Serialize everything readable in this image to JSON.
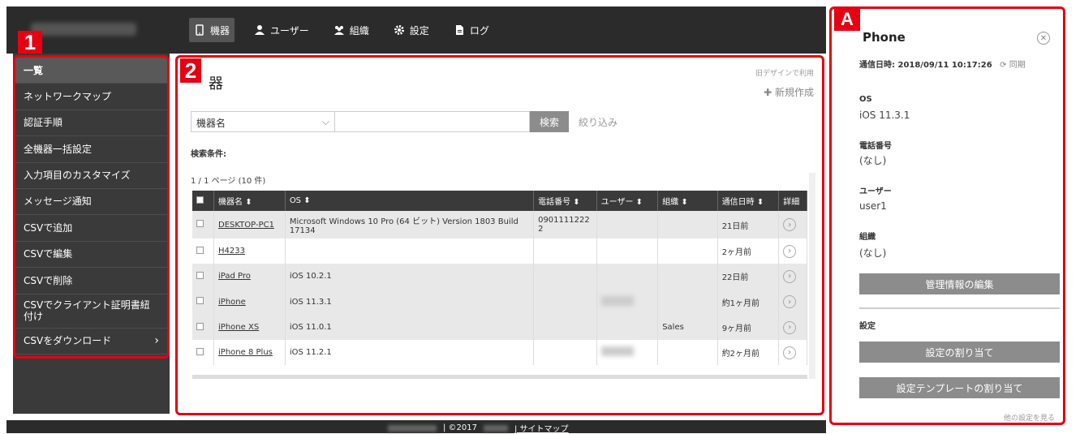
{
  "nav": {
    "items": [
      {
        "label": "機器",
        "icon": "phone-icon",
        "active": true
      },
      {
        "label": "ユーザー",
        "icon": "user-icon",
        "active": false
      },
      {
        "label": "組織",
        "icon": "group-icon",
        "active": false
      },
      {
        "label": "設定",
        "icon": "gear-icon",
        "active": false
      },
      {
        "label": "ログ",
        "icon": "document-icon",
        "active": false
      }
    ]
  },
  "badges": {
    "one": "1",
    "two": "2",
    "a": "A"
  },
  "sidebar": {
    "items": [
      {
        "label": "一覧"
      },
      {
        "label": "ネットワークマップ"
      },
      {
        "label": "認証手順"
      },
      {
        "label": "全機器一括設定"
      },
      {
        "label": "入力項目のカスタマイズ"
      },
      {
        "label": "メッセージ通知"
      },
      {
        "label": "CSVで追加"
      },
      {
        "label": "CSVで編集"
      },
      {
        "label": "CSVで削除"
      },
      {
        "label": "CSVでクライアント証明書紐付け"
      },
      {
        "label": "CSVをダウンロード"
      }
    ]
  },
  "main": {
    "title": "器",
    "old_design": "旧デザインで利用",
    "new_create": "✚ 新規作成",
    "search_select": "機器名",
    "search_button": "検索",
    "filter": "絞り込み",
    "conditions": "検索条件:",
    "page_info": "1 / 1 ページ (10 件)",
    "columns": [
      "機器名 ⬍",
      "OS ⬍",
      "電話番号 ⬍",
      "ユーザー ⬍",
      "組織 ⬍",
      "通信日時 ⬍",
      "詳細"
    ],
    "rows": [
      {
        "name": "DESKTOP-PC1",
        "os": "Microsoft Windows 10 Pro (64 ビット) Version 1803 Build 17134",
        "phone": "0901111222 2",
        "user": "",
        "org": "",
        "time": "21日前"
      },
      {
        "name": "H4233",
        "os": "",
        "phone": "",
        "user": "",
        "org": "",
        "time": "2ヶ月前"
      },
      {
        "name": "iPad Pro",
        "os": "iOS 10.2.1",
        "phone": "",
        "user": "",
        "org": "",
        "time": "22日前"
      },
      {
        "name": "iPhone",
        "os": "iOS 11.3.1",
        "phone": "",
        "user": "blur",
        "org": "",
        "time": "約1ヶ月前"
      },
      {
        "name": "iPhone XS",
        "os": "iOS 11.0.1",
        "phone": "",
        "user": "",
        "org": "Sales",
        "time": "9ヶ月前"
      },
      {
        "name": "iPhone 8 Plus",
        "os": "iOS 11.2.1",
        "phone": "",
        "user": "blur",
        "org": "",
        "time": "約2ヶ月前"
      }
    ]
  },
  "detail": {
    "title": "Phone",
    "date_label": "通信日時: 2018/09/11 10:17:26",
    "sync": "⟳ 同期",
    "os_label": "OS",
    "os_value": "iOS 11.3.1",
    "phone_label": "電話番号",
    "phone_value": "(なし)",
    "user_label": "ユーザー",
    "user_value": "user1",
    "org_label": "組織",
    "org_value": "(なし)",
    "edit_button": "管理情報の編集",
    "settings_label": "設定",
    "assign_button": "設定の割り当て",
    "template_button": "設定テンプレートの割り当て",
    "more_link": "他の設定を見る"
  },
  "footer": {
    "copyright": "| ©2017",
    "sitemap": "| サイトマップ"
  },
  "colors": {
    "accent": "#e60012",
    "dark": "#2b2b2b",
    "button": "#8c8c8c"
  }
}
